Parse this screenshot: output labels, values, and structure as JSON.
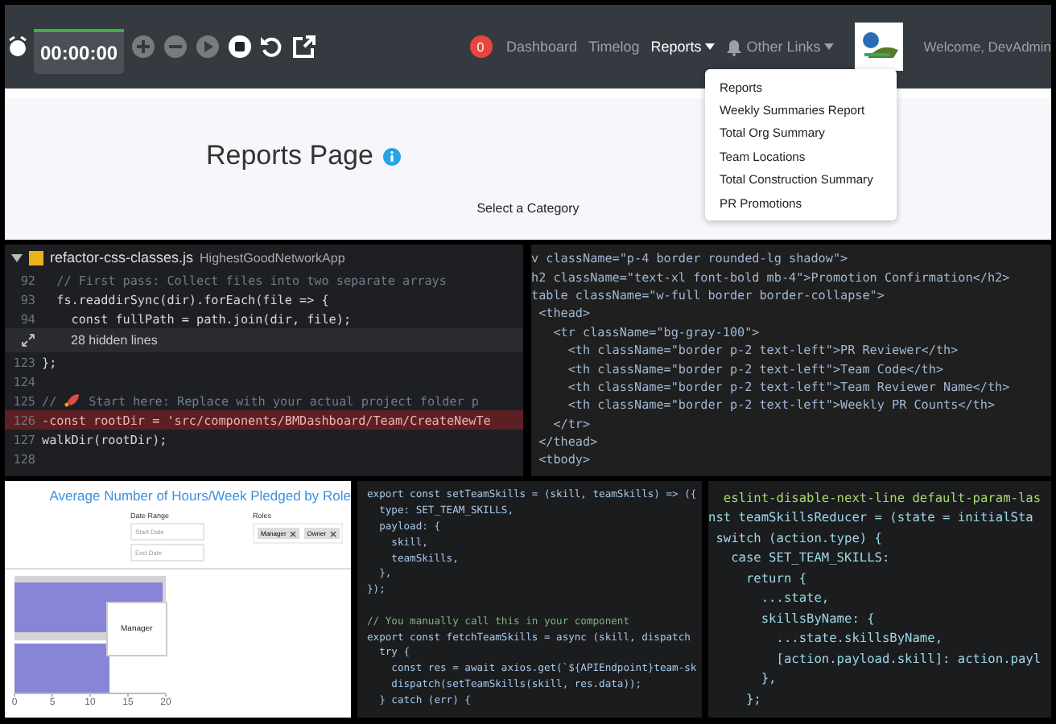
{
  "navbar": {
    "timer": {
      "time": "00:00:00",
      "level": 1
    },
    "timer_controls": [
      {
        "kind": "plus",
        "disabled": true
      },
      {
        "kind": "minus",
        "disabled": true
      },
      {
        "kind": "play",
        "disabled": true
      },
      {
        "kind": "stop",
        "disabled": false
      },
      {
        "kind": "undo",
        "disabled": false
      },
      {
        "kind": "external",
        "disabled": false
      }
    ],
    "notification_badge": "0",
    "nav_items": [
      {
        "label": "Dashboard",
        "selected": false,
        "kind": "link"
      },
      {
        "label": "Timelog",
        "selected": false,
        "kind": "link"
      },
      {
        "label": "Reports",
        "selected": true,
        "kind": "dropdown"
      },
      {
        "label": "Other Links",
        "selected": false,
        "kind": "bell_dropdown"
      }
    ],
    "welcome": "Welcome, DevAdmin"
  },
  "reports_menu": [
    "Reports",
    "Weekly Summaries Report",
    "Total Org Summary",
    "Team Locations",
    "Total Construction Summary",
    "PR Promotions"
  ],
  "page": {
    "title": "Reports Page",
    "subtitle": "Select a Category"
  },
  "editor_diff": {
    "file": "refactor-css-classes.js",
    "project": "HighestGoodNetworkApp",
    "lines": [
      {
        "num": "92",
        "kind": "comment",
        "text": "  // First pass: Collect files into two separate arrays"
      },
      {
        "num": "93",
        "kind": "code",
        "text": "  fs.readdirSync(dir).forEach(file => {"
      },
      {
        "num": "94",
        "kind": "code",
        "text": "    const fullPath = path.join(dir, file);"
      },
      {
        "kind": "hidden",
        "text": "28 hidden lines"
      },
      {
        "num": "123",
        "kind": "code",
        "text": "};"
      },
      {
        "num": "124",
        "kind": "blank"
      },
      {
        "num": "125",
        "kind": "rocket_comment",
        "prefix": "//",
        "text": "Start here: Replace with your actual project folder p"
      },
      {
        "num": "126",
        "kind": "removed",
        "text": "-const rootDir = 'src/components/BMDashboard/Team/CreateNewTe"
      },
      {
        "num": "127",
        "kind": "code",
        "text": "walkDir(rootDir);"
      },
      {
        "num": "128",
        "kind": "blank"
      }
    ]
  },
  "jsx_code": {
    "lines": [
      "v className=\"p-4 border rounded-lg shadow\">",
      "h2 className=\"text-xl font-bold mb-4\">Promotion Confirmation</h2>",
      "table className=\"w-full border border-collapse\">",
      " <thead>",
      "   <tr className=\"bg-gray-100\">",
      "     <th className=\"border p-2 text-left\">PR Reviewer</th>",
      "     <th className=\"border p-2 text-left\">Team Code</th>",
      "     <th className=\"border p-2 text-left\">Team Reviewer Name</th>",
      "     <th className=\"border p-2 text-left\">Weekly PR Counts</th>",
      "   </tr>",
      " </thead>",
      " <tbody>"
    ]
  },
  "chart_panel": {
    "title": "Average Number of Hours/Week Pledged by Role",
    "date_range_label": "Date Range",
    "start_placeholder": "Start Date",
    "end_placeholder": "End Date",
    "roles_label": "Roles",
    "role_tags": [
      "Manager",
      "Owner"
    ],
    "tooltip": "Manager",
    "axis_labels": [
      "0",
      "5",
      "10",
      "15",
      "20"
    ]
  },
  "actions_code": {
    "lines": [
      {
        "kind": "code",
        "text": "export const setTeamSkills = (skill, teamSkills) => ({"
      },
      {
        "kind": "code",
        "text": "  type: SET_TEAM_SKILLS,"
      },
      {
        "kind": "code",
        "text": "  payload: {"
      },
      {
        "kind": "code",
        "text": "    skill,"
      },
      {
        "kind": "code",
        "text": "    teamSkills,"
      },
      {
        "kind": "code",
        "text": "  },"
      },
      {
        "kind": "code",
        "text": "});"
      },
      {
        "kind": "blank"
      },
      {
        "kind": "comment",
        "text": "// You manually call this in your component"
      },
      {
        "kind": "code",
        "text": "export const fetchTeamSkills = async (skill, dispatch"
      },
      {
        "kind": "code",
        "text": "  try {"
      },
      {
        "kind": "code",
        "text": "    const res = await axios.get(`${APIEndpoint}team-sk"
      },
      {
        "kind": "code",
        "text": "    dispatch(setTeamSkills(skill, res.data));"
      },
      {
        "kind": "code",
        "text": "  } catch (err) {"
      }
    ]
  },
  "reducer_code": {
    "lines": [
      {
        "kind": "comment",
        "text": "  eslint-disable-next-line default-param-las"
      },
      {
        "kind": "code",
        "text": "nst teamSkillsReducer = (state = initialSta"
      },
      {
        "kind": "code",
        "text": " switch (action.type) {"
      },
      {
        "kind": "code",
        "text": "   case SET_TEAM_SKILLS:"
      },
      {
        "kind": "code",
        "text": "     return {"
      },
      {
        "kind": "code",
        "text": "       ...state,"
      },
      {
        "kind": "code",
        "text": "       skillsByName: {"
      },
      {
        "kind": "code",
        "text": "         ...state.skillsByName,"
      },
      {
        "kind": "code",
        "text": "         [action.payload.skill]: action.payl"
      },
      {
        "kind": "code",
        "text": "       },"
      },
      {
        "kind": "code",
        "text": "     };"
      }
    ]
  }
}
